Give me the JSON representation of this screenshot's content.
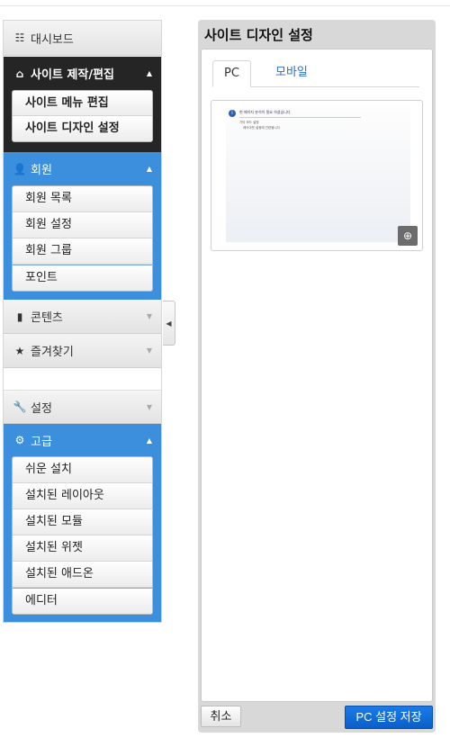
{
  "sidebar": {
    "dashboard": {
      "label": "대시보드",
      "icon": "list-icon"
    },
    "site_build": {
      "label": "사이트 제작/편집",
      "icon": "home-icon",
      "items": [
        {
          "label": "사이트 메뉴 편집"
        },
        {
          "label": "사이트 디자인 설정",
          "active": true
        }
      ]
    },
    "member": {
      "label": "회원",
      "icon": "user-icon",
      "items": [
        {
          "label": "회원 목록"
        },
        {
          "label": "회원 설정"
        },
        {
          "label": "회원 그룹"
        },
        {
          "label": "포인트"
        }
      ]
    },
    "contents": {
      "label": "콘텐츠",
      "icon": "book-icon"
    },
    "favorites": {
      "label": "즐겨찾기",
      "icon": "star-icon"
    },
    "settings": {
      "label": "설정",
      "icon": "wrench-icon"
    },
    "advanced": {
      "label": "고급",
      "icon": "gear-icon",
      "items": [
        {
          "label": "쉬운 설치"
        },
        {
          "label": "설치된 레이아웃"
        },
        {
          "label": "설치된 모듈"
        },
        {
          "label": "설치된 위젯"
        },
        {
          "label": "설치된 애드온"
        },
        {
          "label": "에디터"
        }
      ]
    }
  },
  "panel": {
    "title": "사이트 디자인 설정",
    "tabs": [
      {
        "label": "PC",
        "active": true
      },
      {
        "label": "모바일",
        "active": false
      }
    ],
    "preview": {
      "heading": "현 페이지 분석이 필요 하셨습니다",
      "line1": "기타 모드 설정",
      "line2": "레이아웃 설정에 관련됩니다"
    },
    "cancel_label": "취소",
    "save_label": "PC 설정 저장"
  },
  "colors": {
    "dark_section": "#252525",
    "blue_section": "#3c8fdc",
    "save_button": "#0a6fd8",
    "tab_link": "#2a6fd6"
  }
}
